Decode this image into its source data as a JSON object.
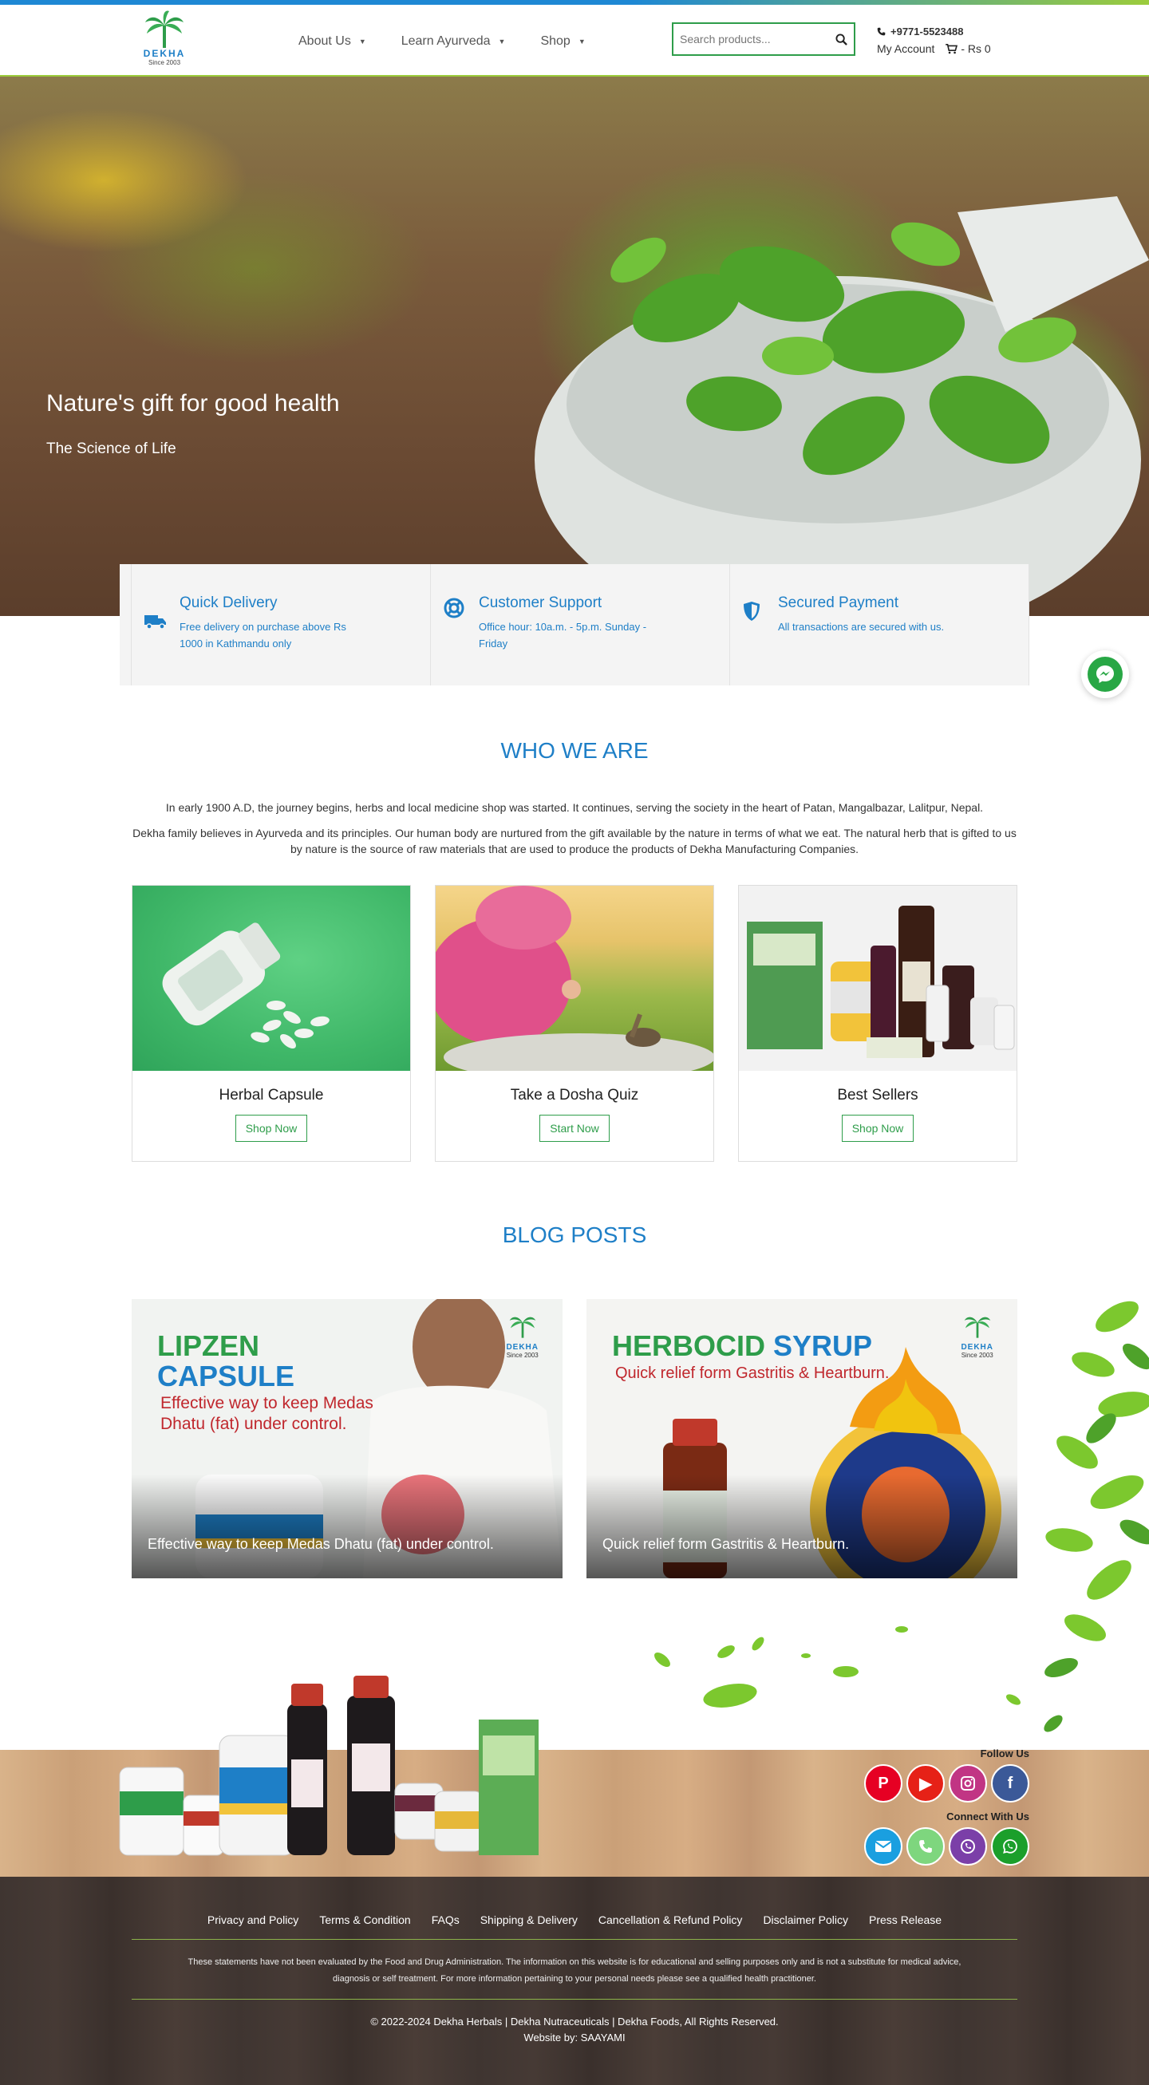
{
  "header": {
    "brand": "DEKHA",
    "since": "Since 2003",
    "nav": [
      {
        "label": "About Us"
      },
      {
        "label": "Learn Ayurveda"
      },
      {
        "label": "Shop"
      }
    ],
    "search_placeholder": "Search products...",
    "phone": "+9771-5523488",
    "account_label": "My Account",
    "cart_total": "- Rs 0"
  },
  "hero": {
    "title": "Nature's gift for good health",
    "subtitle": "The Science of Life"
  },
  "features": [
    {
      "title": "Quick Delivery",
      "desc": "Free delivery on purchase above Rs 1000 in Kathmandu only",
      "icon": "truck-icon"
    },
    {
      "title": "Customer Support",
      "desc": "Office hour: 10a.m. - 5p.m. Sunday - Friday",
      "icon": "lifebuoy-icon"
    },
    {
      "title": "Secured Payment",
      "desc": "All transactions are secured with us.",
      "icon": "shield-icon"
    }
  ],
  "who": {
    "title": "WHO WE ARE",
    "p1": "In early 1900 A.D, the journey begins, herbs and local medicine shop was started. It continues, serving the society in the heart of Patan, Mangalbazar, Lalitpur, Nepal.",
    "p2": "Dekha family believes in Ayurveda and its principles. Our human body are nurtured from the gift available by the nature in terms of what we eat. The natural herb that is gifted to us by nature is the source of raw materials that are used to produce the products of Dekha Manufacturing Companies."
  },
  "cards": [
    {
      "title": "Herbal Capsule",
      "button": "Shop Now"
    },
    {
      "title": "Take a Dosha Quiz",
      "button": "Start Now"
    },
    {
      "title": "Best Sellers",
      "button": "Shop Now"
    }
  ],
  "blog": {
    "title": "BLOG POSTS",
    "posts": [
      {
        "heading_a": "LIPZEN",
        "heading_b": "CAPSULE",
        "tagline": "Effective way to keep Medas Dhatu (fat) under control.",
        "caption": "Effective way to keep Medas Dhatu (fat) under control."
      },
      {
        "heading_a": "HERBOCID",
        "heading_b": "SYRUP",
        "tagline": "Quick relief form Gastritis & Heartburn.",
        "caption": "Quick relief form Gastritis & Heartburn."
      }
    ]
  },
  "social": {
    "follow_label": "Follow Us",
    "connect_label": "Connect With Us",
    "follow": [
      {
        "name": "pinterest",
        "color": "#e60023"
      },
      {
        "name": "youtube",
        "color": "#e62117"
      },
      {
        "name": "instagram",
        "color": "#c13584"
      },
      {
        "name": "facebook",
        "color": "#3b5998"
      }
    ],
    "connect": [
      {
        "name": "email",
        "color": "#1a9fe0"
      },
      {
        "name": "phone",
        "color": "#7ed67e"
      },
      {
        "name": "viber",
        "color": "#7b3fa8"
      },
      {
        "name": "whatsapp",
        "color": "#1b9f2b"
      }
    ]
  },
  "footer": {
    "links": [
      "Privacy and Policy",
      "Terms & Condition",
      "FAQs",
      "Shipping & Delivery",
      "Cancellation & Refund Policy",
      "Disclaimer Policy",
      "Press Release"
    ],
    "disclaimer_1": "These statements have not been evaluated by the Food and Drug Administration. The information on this website is for educational and selling purposes only and is not a substitute for medical advice,",
    "disclaimer_2": "diagnosis or self treatment. For more information pertaining to your personal needs please see a qualified health practitioner.",
    "copyright": "© 2022-2024 Dekha Herbals | Dekha Nutraceuticals | Dekha Foods, All Rights Reserved.",
    "credit": "Website by: SAAYAMI"
  },
  "colors": {
    "primary_blue": "#1e7fc7",
    "green": "#2e9d4a",
    "lime": "#9ccc3c"
  }
}
